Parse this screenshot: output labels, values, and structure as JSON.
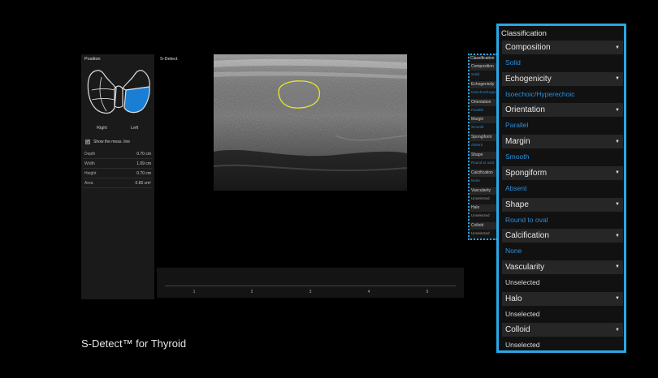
{
  "position_panel": {
    "title": "Position",
    "right_label": "Right",
    "left_label": "Left",
    "show_meas_line": "Show the meas. line",
    "measurements": [
      {
        "label": "Depth",
        "value": "0.70 cm"
      },
      {
        "label": "Width",
        "value": "1.09 cm"
      },
      {
        "label": "Height",
        "value": "0.70 cm"
      },
      {
        "label": "Area",
        "value": "0.60 cm²"
      }
    ]
  },
  "sdetect": {
    "label": "S-Detect"
  },
  "timeline": {
    "ticks": [
      "1",
      "2",
      "3",
      "4",
      "5"
    ]
  },
  "mini_panel": {
    "title": "Classification",
    "items": [
      {
        "name": "Composition",
        "value": "Solid"
      },
      {
        "name": "Echogenicity",
        "value": "Isoechoic/Hyperechoic"
      },
      {
        "name": "Orientation",
        "value": "Parallel"
      },
      {
        "name": "Margin",
        "value": "Smooth"
      },
      {
        "name": "Spongiform",
        "value": "Absent"
      },
      {
        "name": "Shape",
        "value": "Round to oval"
      },
      {
        "name": "Calcification",
        "value": "None"
      },
      {
        "name": "Vascularity",
        "value": "Unselected"
      },
      {
        "name": "Halo",
        "value": "Unselected"
      },
      {
        "name": "Colloid",
        "value": "Unselected"
      }
    ]
  },
  "classification": {
    "title": "Classification",
    "items": [
      {
        "name": "Composition",
        "value": "Solid",
        "selected": true
      },
      {
        "name": "Echogenicity",
        "value": "Isoechoic/Hyperechoic",
        "selected": true
      },
      {
        "name": "Orientation",
        "value": "Parallel",
        "selected": true
      },
      {
        "name": "Margin",
        "value": "Smooth",
        "selected": true
      },
      {
        "name": "Spongiform",
        "value": "Absent",
        "selected": true
      },
      {
        "name": "Shape",
        "value": "Round to oval",
        "selected": true
      },
      {
        "name": "Calcification",
        "value": "None",
        "selected": true
      },
      {
        "name": "Vascularity",
        "value": "Unselected",
        "selected": false
      },
      {
        "name": "Halo",
        "value": "Unselected",
        "selected": false
      },
      {
        "name": "Colloid",
        "value": "Unselected",
        "selected": false
      }
    ]
  },
  "caption": "S-Detect™ for Thyroid",
  "colors": {
    "accent": "#2aa7e6",
    "value_blue": "#2d8ed8",
    "thyroid_selected": "#1a7fd4",
    "roi_yellow": "#e6e633"
  }
}
